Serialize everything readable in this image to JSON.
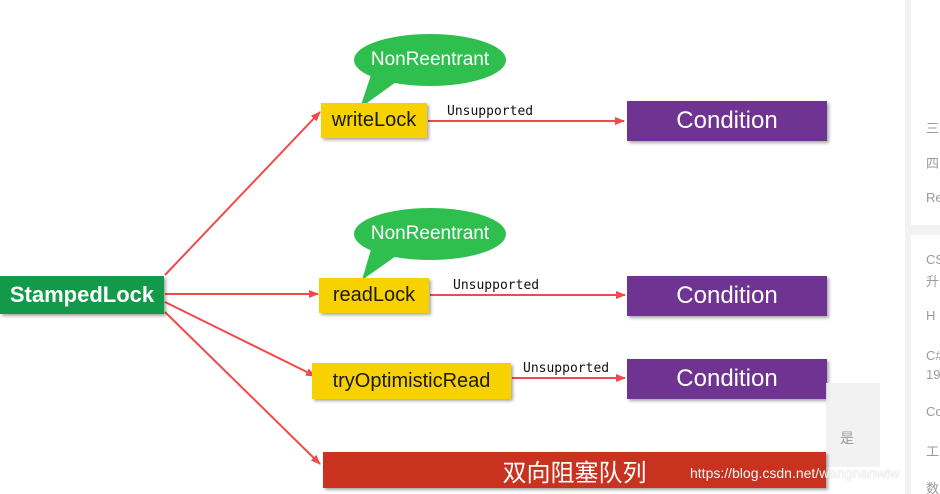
{
  "diagram": {
    "root": "StampedLock",
    "locks": [
      {
        "label": "writeLock",
        "bubble": "NonReentrant",
        "edge_label": "Unsupported",
        "target": "Condition"
      },
      {
        "label": "readLock",
        "bubble": "NonReentrant",
        "edge_label": "Unsupported",
        "target": "Condition"
      },
      {
        "label": "tryOptimisticRead",
        "edge_label": "Unsupported",
        "target": "Condition"
      }
    ],
    "queue": "双向阻塞队列"
  },
  "colors": {
    "root": "#12994a",
    "lock": "#f7d100",
    "condition": "#6f3491",
    "bubble": "#2fbf4f",
    "queue": "#c8321f",
    "arrow": "#f04a4a"
  },
  "watermark": "https://blog.csdn.net/wangnanwlw",
  "overlay_char": "是",
  "sidebar": {
    "items": [
      "三",
      "四",
      "Re",
      "CS",
      "升",
      "H",
      "C#",
      "19",
      "Co",
      "工",
      "数"
    ]
  }
}
